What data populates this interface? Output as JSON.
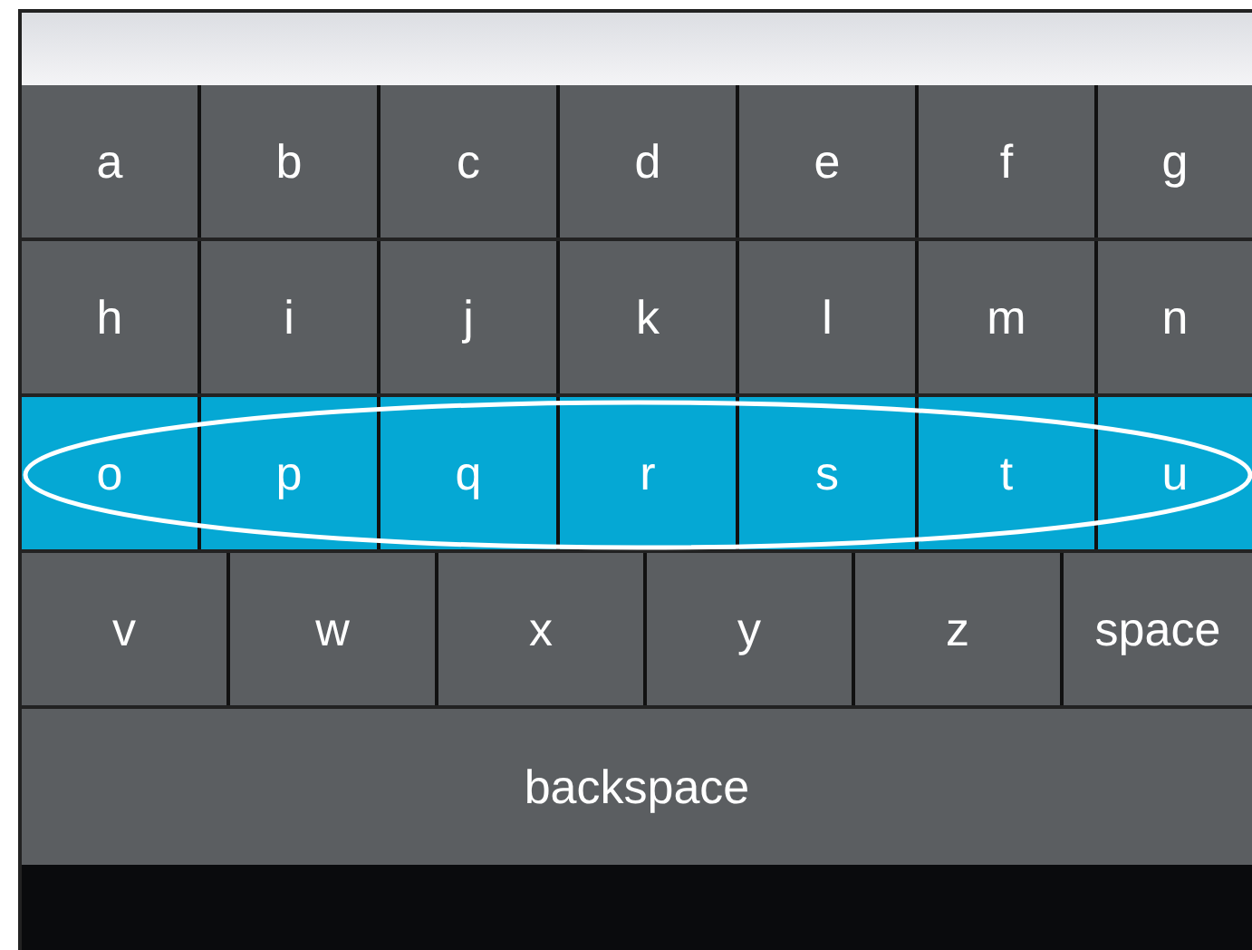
{
  "keyboard": {
    "rows": [
      {
        "kind": "letters",
        "selected": false,
        "keys": [
          "a",
          "b",
          "c",
          "d",
          "e",
          "f",
          "g"
        ]
      },
      {
        "kind": "letters",
        "selected": false,
        "keys": [
          "h",
          "i",
          "j",
          "k",
          "l",
          "m",
          "n"
        ]
      },
      {
        "kind": "letters",
        "selected": true,
        "keys": [
          "o",
          "p",
          "q",
          "r",
          "s",
          "t",
          "u"
        ]
      },
      {
        "kind": "wide",
        "selected": false,
        "keys": [
          "v",
          "w",
          "x",
          "y",
          "z",
          "space"
        ]
      },
      {
        "kind": "full",
        "selected": false,
        "keys": [
          "backspace"
        ]
      }
    ]
  }
}
